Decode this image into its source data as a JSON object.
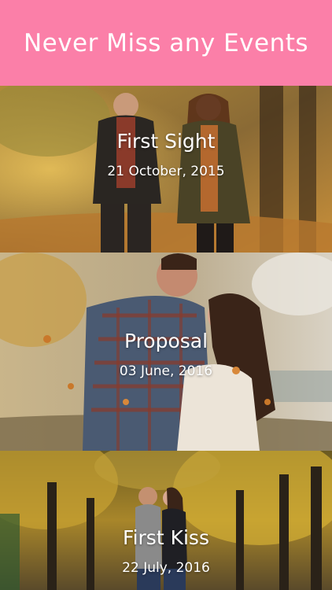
{
  "header": {
    "title": "Never Miss any Events",
    "background": "#fb7fa8"
  },
  "events": [
    {
      "title": "First Sight",
      "date": "21 October, 2015"
    },
    {
      "title": "Proposal",
      "date": "03 June, 2016"
    },
    {
      "title": "First Kiss",
      "date": "22 July, 2016"
    }
  ]
}
